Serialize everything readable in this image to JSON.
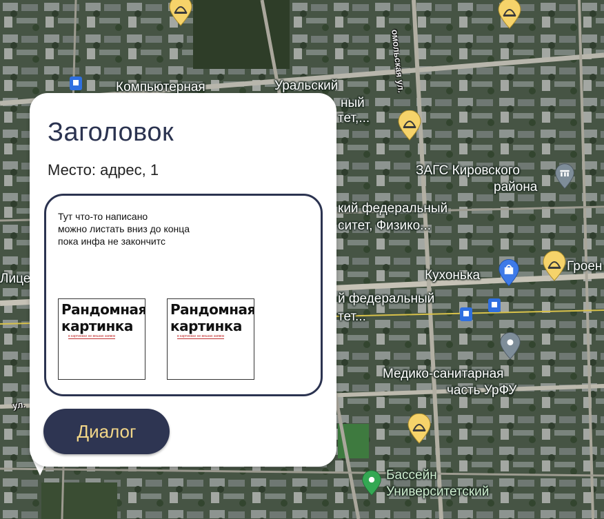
{
  "map": {
    "labels": {
      "computer": "Компьютерная",
      "ural": "Уральский",
      "ural_l2": "ный",
      "ural_l3": "тет,...",
      "zags_l1": "ЗАГС Кировского",
      "zags_l2": "района",
      "fed1_l1": "кий федеральный",
      "fed1_l2": "ситет, Физико...",
      "kuhonka": "Кухонька",
      "groen": "Гроен",
      "fed2_l1": "й федеральный",
      "fed2_l2": "тет...",
      "lice": "Лице",
      "med_l1": "Медико-санитарная",
      "med_l2": "часть УрФУ",
      "pool_l1": "Бассейн",
      "pool_l2": "Университетский",
      "street_komsomol": "омольская ул.",
      "street_ul": "ул."
    },
    "pins": [
      "restaurant-pin",
      "restaurant-pin",
      "restaurant-pin",
      "restaurant-pin",
      "restaurant-pin",
      "shopping-pin",
      "location-pin",
      "pool-pin",
      "government-pin",
      "transit-icon"
    ],
    "colors": {
      "restaurant_pin": "#f6d36a",
      "shopping_pin": "#3e7ae8",
      "pool_pin": "#34a853",
      "location_pin": "#7e8d99"
    }
  },
  "popup": {
    "title": "Заголовок",
    "place": "Место: адрес, 1",
    "content_lines": [
      "Тут что-то написано",
      "можно листать вниз до конца",
      "пока инфа не закончитс"
    ],
    "images": [
      {
        "title_l1": "Рандомная",
        "title_l2": "картинка",
        "caption": "в картинках не вешаю заявок"
      },
      {
        "title_l1": "Рандомная",
        "title_l2": "картинка",
        "caption": "в картинках не вешаю заявок"
      }
    ],
    "dialog_button": "Диалог"
  }
}
